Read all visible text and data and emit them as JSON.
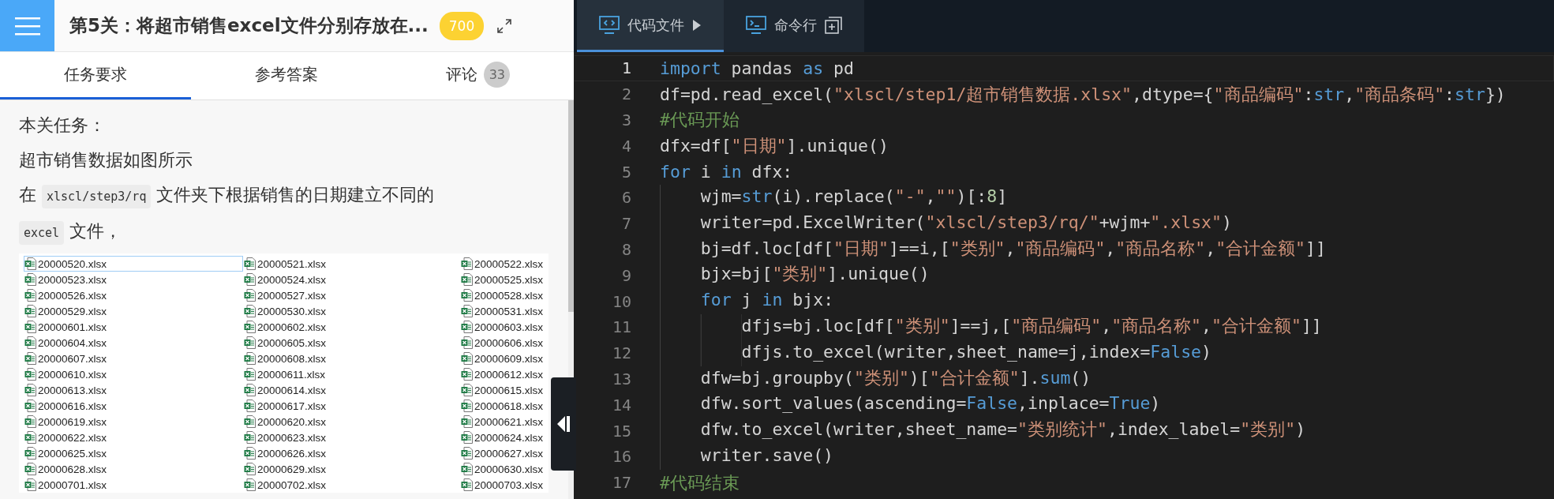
{
  "header": {
    "title": "第5关：将超市销售excel文件分别存放在...",
    "score": "700"
  },
  "tabs": [
    {
      "label": "任务要求",
      "selected": true
    },
    {
      "label": "参考答案",
      "selected": false
    },
    {
      "label": "评论",
      "count": "33",
      "selected": false
    }
  ],
  "content": {
    "paragraphs": [
      [
        {
          "kind": "text",
          "text": "本关任务："
        }
      ],
      [
        {
          "kind": "text",
          "text": "超市销售数据如图所示"
        }
      ],
      [
        {
          "kind": "text",
          "text": "在 "
        },
        {
          "kind": "code",
          "text": "xlscl/step3/rq"
        },
        {
          "kind": "text",
          "text": " 文件夹下根据销售的日期建立不同的 "
        },
        {
          "kind": "code",
          "text": "excel"
        },
        {
          "kind": "text",
          "text": " 文件，"
        }
      ]
    ],
    "files": [
      {
        "name": "20000520.xlsx",
        "selected": true
      },
      {
        "name": "20000521.xlsx",
        "selected": false
      },
      {
        "name": "20000522.xlsx",
        "selected": false
      },
      {
        "name": "20000523.xlsx",
        "selected": false
      },
      {
        "name": "20000524.xlsx",
        "selected": false
      },
      {
        "name": "20000525.xlsx",
        "selected": false
      },
      {
        "name": "20000526.xlsx",
        "selected": false
      },
      {
        "name": "20000527.xlsx",
        "selected": false
      },
      {
        "name": "20000528.xlsx",
        "selected": false
      },
      {
        "name": "20000529.xlsx",
        "selected": false
      },
      {
        "name": "20000530.xlsx",
        "selected": false
      },
      {
        "name": "20000531.xlsx",
        "selected": false
      },
      {
        "name": "20000601.xlsx",
        "selected": false
      },
      {
        "name": "20000602.xlsx",
        "selected": false
      },
      {
        "name": "20000603.xlsx",
        "selected": false
      },
      {
        "name": "20000604.xlsx",
        "selected": false
      },
      {
        "name": "20000605.xlsx",
        "selected": false
      },
      {
        "name": "20000606.xlsx",
        "selected": false
      },
      {
        "name": "20000607.xlsx",
        "selected": false
      },
      {
        "name": "20000608.xlsx",
        "selected": false
      },
      {
        "name": "20000609.xlsx",
        "selected": false
      },
      {
        "name": "20000610.xlsx",
        "selected": false
      },
      {
        "name": "20000611.xlsx",
        "selected": false
      },
      {
        "name": "20000612.xlsx",
        "selected": false
      },
      {
        "name": "20000613.xlsx",
        "selected": false
      },
      {
        "name": "20000614.xlsx",
        "selected": false
      },
      {
        "name": "20000615.xlsx",
        "selected": false
      },
      {
        "name": "20000616.xlsx",
        "selected": false
      },
      {
        "name": "20000617.xlsx",
        "selected": false
      },
      {
        "name": "20000618.xlsx",
        "selected": false
      },
      {
        "name": "20000619.xlsx",
        "selected": false
      },
      {
        "name": "20000620.xlsx",
        "selected": false
      },
      {
        "name": "20000621.xlsx",
        "selected": false
      },
      {
        "name": "20000622.xlsx",
        "selected": false
      },
      {
        "name": "20000623.xlsx",
        "selected": false
      },
      {
        "name": "20000624.xlsx",
        "selected": false
      },
      {
        "name": "20000625.xlsx",
        "selected": false
      },
      {
        "name": "20000626.xlsx",
        "selected": false
      },
      {
        "name": "20000627.xlsx",
        "selected": false
      },
      {
        "name": "20000628.xlsx",
        "selected": false
      },
      {
        "name": "20000629.xlsx",
        "selected": false
      },
      {
        "name": "20000630.xlsx",
        "selected": false
      },
      {
        "name": "20000701.xlsx",
        "selected": false
      },
      {
        "name": "20000702.xlsx",
        "selected": false
      },
      {
        "name": "20000703.xlsx",
        "selected": false
      }
    ]
  },
  "editor_tabs": [
    {
      "label": "代码文件",
      "kind": "code",
      "selected": true
    },
    {
      "label": "命令行",
      "kind": "terminal",
      "selected": false
    }
  ],
  "code": [
    {
      "number": "1",
      "current": true,
      "tokens": [
        {
          "kind": "keyword",
          "text": "import"
        },
        {
          "kind": "plain",
          "text": " pandas "
        },
        {
          "kind": "keyword",
          "text": "as"
        },
        {
          "kind": "plain",
          "text": " pd"
        }
      ]
    },
    {
      "number": "2",
      "current": false,
      "tokens": [
        {
          "kind": "plain",
          "text": "df=pd.read_excel("
        },
        {
          "kind": "string",
          "text": "\"xlscl/step1/超市销售数据.xlsx\""
        },
        {
          "kind": "plain",
          "text": ",dtype={"
        },
        {
          "kind": "string",
          "text": "\"商品编码\""
        },
        {
          "kind": "plain",
          "text": ":"
        },
        {
          "kind": "keyword",
          "text": "str"
        },
        {
          "kind": "plain",
          "text": ","
        },
        {
          "kind": "string",
          "text": "\"商品条码\""
        },
        {
          "kind": "plain",
          "text": ":"
        },
        {
          "kind": "keyword",
          "text": "str"
        },
        {
          "kind": "plain",
          "text": "})"
        }
      ]
    },
    {
      "number": "3",
      "current": false,
      "tokens": [
        {
          "kind": "comment",
          "text": "#代码开始"
        }
      ]
    },
    {
      "number": "4",
      "current": false,
      "tokens": [
        {
          "kind": "plain",
          "text": "dfx=df["
        },
        {
          "kind": "string",
          "text": "\"日期\""
        },
        {
          "kind": "plain",
          "text": "].unique()"
        }
      ]
    },
    {
      "number": "5",
      "current": false,
      "tokens": [
        {
          "kind": "keyword",
          "text": "for"
        },
        {
          "kind": "plain",
          "text": " i "
        },
        {
          "kind": "keyword",
          "text": "in"
        },
        {
          "kind": "plain",
          "text": " dfx:"
        }
      ]
    },
    {
      "number": "6",
      "current": false,
      "tokens": [
        {
          "kind": "plain",
          "text": "    wjm="
        },
        {
          "kind": "keyword",
          "text": "str"
        },
        {
          "kind": "plain",
          "text": "(i).replace("
        },
        {
          "kind": "string",
          "text": "\"-\""
        },
        {
          "kind": "plain",
          "text": ","
        },
        {
          "kind": "string",
          "text": "\"\""
        },
        {
          "kind": "plain",
          "text": ")[:"
        },
        {
          "kind": "number",
          "text": "8"
        },
        {
          "kind": "plain",
          "text": "]"
        }
      ]
    },
    {
      "number": "7",
      "current": false,
      "tokens": [
        {
          "kind": "plain",
          "text": "    writer=pd.ExcelWriter("
        },
        {
          "kind": "string",
          "text": "\"xlscl/step3/rq/\""
        },
        {
          "kind": "plain",
          "text": "+wjm+"
        },
        {
          "kind": "string",
          "text": "\".xlsx\""
        },
        {
          "kind": "plain",
          "text": ")"
        }
      ]
    },
    {
      "number": "8",
      "current": false,
      "tokens": [
        {
          "kind": "plain",
          "text": "    bj=df.loc[df["
        },
        {
          "kind": "string",
          "text": "\"日期\""
        },
        {
          "kind": "plain",
          "text": "]==i,["
        },
        {
          "kind": "string",
          "text": "\"类别\""
        },
        {
          "kind": "plain",
          "text": ","
        },
        {
          "kind": "string",
          "text": "\"商品编码\""
        },
        {
          "kind": "plain",
          "text": ","
        },
        {
          "kind": "string",
          "text": "\"商品名称\""
        },
        {
          "kind": "plain",
          "text": ","
        },
        {
          "kind": "string",
          "text": "\"合计金额\""
        },
        {
          "kind": "plain",
          "text": "]]"
        }
      ]
    },
    {
      "number": "9",
      "current": false,
      "tokens": [
        {
          "kind": "plain",
          "text": "    bjx=bj["
        },
        {
          "kind": "string",
          "text": "\"类别\""
        },
        {
          "kind": "plain",
          "text": "].unique()"
        }
      ]
    },
    {
      "number": "10",
      "current": false,
      "tokens": [
        {
          "kind": "keyword",
          "text": "    for"
        },
        {
          "kind": "plain",
          "text": " j "
        },
        {
          "kind": "keyword",
          "text": "in"
        },
        {
          "kind": "plain",
          "text": " bjx:"
        }
      ]
    },
    {
      "number": "11",
      "current": false,
      "tokens": [
        {
          "kind": "plain",
          "text": "        dfjs=bj.loc[df["
        },
        {
          "kind": "string",
          "text": "\"类别\""
        },
        {
          "kind": "plain",
          "text": "]==j,["
        },
        {
          "kind": "string",
          "text": "\"商品编码\""
        },
        {
          "kind": "plain",
          "text": ","
        },
        {
          "kind": "string",
          "text": "\"商品名称\""
        },
        {
          "kind": "plain",
          "text": ","
        },
        {
          "kind": "string",
          "text": "\"合计金额\""
        },
        {
          "kind": "plain",
          "text": "]]"
        }
      ]
    },
    {
      "number": "12",
      "current": false,
      "tokens": [
        {
          "kind": "plain",
          "text": "        dfjs.to_excel(writer,sheet_name=j,index="
        },
        {
          "kind": "keyword",
          "text": "False"
        },
        {
          "kind": "plain",
          "text": ")"
        }
      ]
    },
    {
      "number": "13",
      "current": false,
      "tokens": [
        {
          "kind": "plain",
          "text": "    dfw=bj.groupby("
        },
        {
          "kind": "string",
          "text": "\"类别\""
        },
        {
          "kind": "plain",
          "text": ")["
        },
        {
          "kind": "string",
          "text": "\"合计金额\""
        },
        {
          "kind": "plain",
          "text": "]."
        },
        {
          "kind": "keyword",
          "text": "sum"
        },
        {
          "kind": "plain",
          "text": "()"
        }
      ]
    },
    {
      "number": "14",
      "current": false,
      "tokens": [
        {
          "kind": "plain",
          "text": "    dfw.sort_values(ascending="
        },
        {
          "kind": "keyword",
          "text": "False"
        },
        {
          "kind": "plain",
          "text": ",inplace="
        },
        {
          "kind": "keyword",
          "text": "True"
        },
        {
          "kind": "plain",
          "text": ")"
        }
      ]
    },
    {
      "number": "15",
      "current": false,
      "tokens": [
        {
          "kind": "plain",
          "text": "    dfw.to_excel(writer,sheet_name="
        },
        {
          "kind": "string",
          "text": "\"类别统计\""
        },
        {
          "kind": "plain",
          "text": ",index_label="
        },
        {
          "kind": "string",
          "text": "\"类别\""
        },
        {
          "kind": "plain",
          "text": ")"
        }
      ]
    },
    {
      "number": "16",
      "current": false,
      "tokens": [
        {
          "kind": "plain",
          "text": "    writer.save()"
        }
      ]
    },
    {
      "number": "17",
      "current": false,
      "tokens": [
        {
          "kind": "comment",
          "text": "#代码结束"
        }
      ]
    }
  ]
}
